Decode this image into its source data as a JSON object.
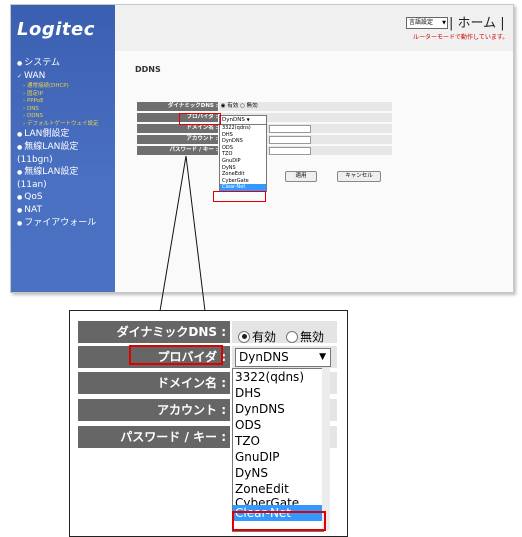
{
  "app": {
    "logo": "Logitec",
    "language_select": "言語設定",
    "home_label": "| ホーム |",
    "router_msg": "ルーターモードで動作しています。"
  },
  "nav": {
    "items": [
      {
        "label": "システム"
      },
      {
        "label": "WAN"
      },
      {
        "label": "通常接続(DHCP)"
      },
      {
        "label": "固定IP"
      },
      {
        "label": "PPPoE"
      },
      {
        "label": "DNS"
      },
      {
        "label": "DDNS"
      },
      {
        "label": "デフォルトゲートウェイ設定"
      },
      {
        "label": "LAN側設定"
      },
      {
        "label": "無線LAN設定"
      },
      {
        "label": "(11bgn)"
      },
      {
        "label": "無線LAN設定"
      },
      {
        "label": "(11an)"
      },
      {
        "label": "QoS"
      },
      {
        "label": "NAT"
      },
      {
        "label": "ファイアウォール"
      }
    ]
  },
  "page": {
    "title": "DDNS"
  },
  "form": {
    "dynamic_dns_label": "ダイナミックDNS :",
    "enabled_label": "有効",
    "disabled_label": "無効",
    "provider_label": "プロバイダ :",
    "provider_value": "DynDNS",
    "domain_label": "ドメイン名 :",
    "account_label": "アカウント :",
    "password_label": "パスワード / キー :",
    "apply_label": "適用",
    "cancel_label": "キャンセル"
  },
  "provider_options": [
    "3322(qdns)",
    "DHS",
    "DynDNS",
    "ODS",
    "TZO",
    "GnuDIP",
    "DyNS",
    "ZoneEdit",
    "CyberGate",
    "Clear-Net"
  ],
  "selected_option": "Clear-Net",
  "colors": {
    "highlight": "#e00000",
    "selection": "#3399ff",
    "sidebar": "#4a70c2",
    "label_bg": "#666666"
  }
}
